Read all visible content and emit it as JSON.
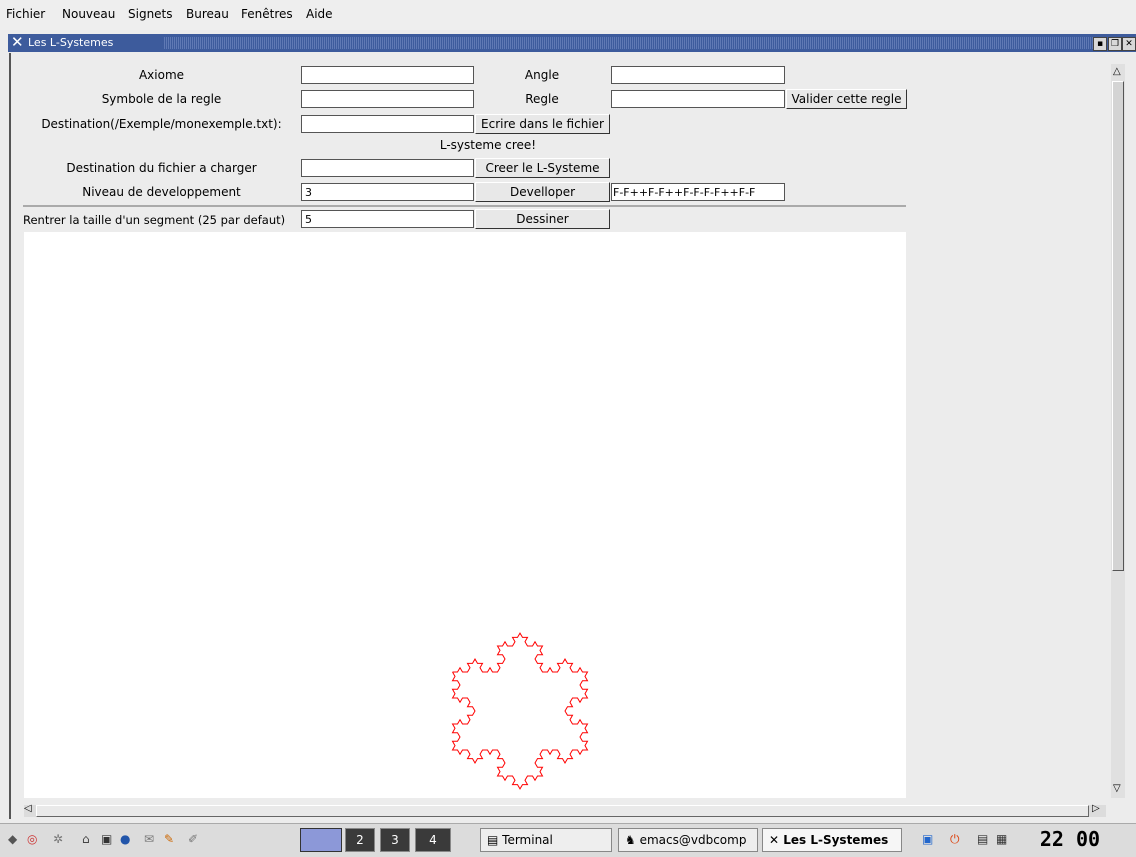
{
  "menubar": {
    "items": [
      "Fichier",
      "Nouveau",
      "Signets",
      "Bureau",
      "Fenêtres",
      "Aide"
    ]
  },
  "window": {
    "title": "Les L-Systemes"
  },
  "form": {
    "axiome_label": "Axiome",
    "angle_label": "Angle",
    "symbole_label": "Symbole de la regle",
    "regle_label": "Regle",
    "valider_button": "Valider cette regle",
    "destination_label": "Destination(/Exemple/monexemple.txt):",
    "ecrire_button": "Ecrire dans le fichier",
    "status": "L-systeme cree!",
    "fichier_label": "Destination du fichier a charger",
    "creer_button": "Creer le L-Systeme",
    "niveau_label": "Niveau de developpement",
    "niveau_value": "3",
    "developper_button": "Develloper",
    "result_value": "F-F++F-F++F-F-F-F++F-F",
    "taille_label": "Rentrer la taille d'un segment (25 par defaut)",
    "taille_value": "5",
    "dessiner_button": "Dessiner",
    "axiome_value": "",
    "angle_value": "",
    "symbole_value": "",
    "regle_value": "",
    "destination_value": "",
    "fichier_value": ""
  },
  "drawing": {
    "stroke_color": "#ff0000",
    "shape": "koch-snowflake",
    "level": 3,
    "segment_size": 5
  },
  "taskbar": {
    "workspaces": [
      "2",
      "3",
      "4"
    ],
    "tasks": [
      "Terminal",
      "emacs@vdbcomp",
      "Les L-Systemes"
    ],
    "clock": "22 00"
  }
}
